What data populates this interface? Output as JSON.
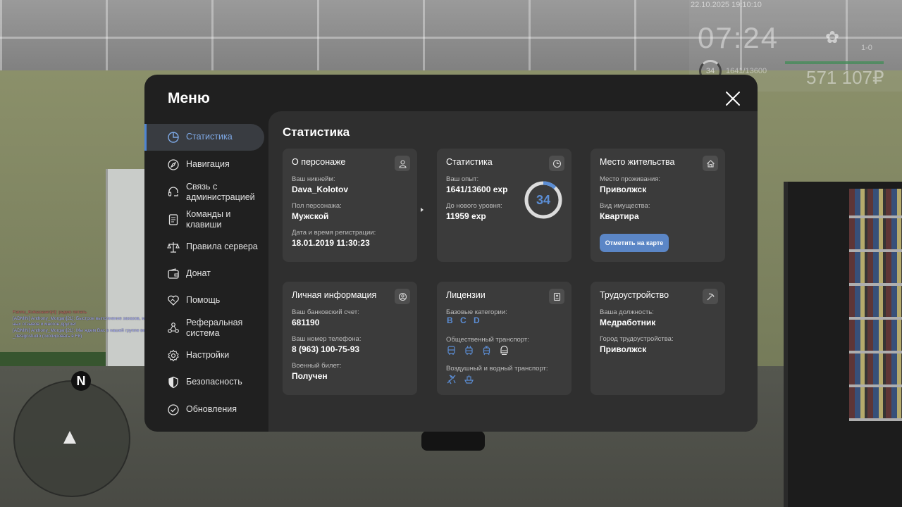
{
  "hud": {
    "datetime": "22.10.2025 19:10:10",
    "time": "07:24",
    "weapon_icon": "grenade-icon",
    "ammo": "1-0",
    "level": "34",
    "exp": "1641/13600",
    "money": "571 107₽"
  },
  "chat": {
    "lines": [
      "Fannu_Kokacasen[4]: радио питать",
      "[ADMIN] Anthony_Morgan[21]: Быстрое выполнение заказов, много положитель",
      "ных отзывов и многое другое!",
      "[ADMIN] Anthony_Morgan[21]: Мы ждем Вас в нашей группе вк: vk.com/effect",
      "_designstudio (скопировать в F8)"
    ]
  },
  "minimap": {
    "north_label": "N"
  },
  "menu": {
    "title": "Меню",
    "close_icon": "close-icon",
    "accent_color": "#4e84d2",
    "sidebar": [
      {
        "label": "Статистика",
        "icon": "pie-chart-icon",
        "active": true
      },
      {
        "label": "Навигация",
        "icon": "compass-icon",
        "active": false
      },
      {
        "label": "Связь с администрацией",
        "icon": "headset-icon",
        "active": false
      },
      {
        "label": "Команды и клавиши",
        "icon": "document-icon",
        "active": false
      },
      {
        "label": "Правила сервера",
        "icon": "scales-icon",
        "active": false
      },
      {
        "label": "Донат",
        "icon": "wallet-icon",
        "active": false
      },
      {
        "label": "Помощь",
        "icon": "heart-handshake-icon",
        "active": false
      },
      {
        "label": "Реферальная система",
        "icon": "share-icon",
        "active": false
      },
      {
        "label": "Настройки",
        "icon": "gear-icon",
        "active": false
      },
      {
        "label": "Безопасность",
        "icon": "shield-icon",
        "active": false
      },
      {
        "label": "Обновления",
        "icon": "check-circle-icon",
        "active": false
      }
    ]
  },
  "content": {
    "title": "Статистика",
    "character": {
      "title": "О персонаже",
      "icon": "user-icon",
      "nickname_label": "Ваш никнейм:",
      "nickname": "Dava_Kolotov",
      "gender_label": "Пол персонажа:",
      "gender": "Мужской",
      "reg_label": "Дата и время регистрации:",
      "reg_date": "18.01.2019 11:30:23"
    },
    "stats": {
      "title": "Статистика",
      "icon": "clock-icon",
      "exp_label": "Ваш опыт:",
      "exp": "1641/13600 exp",
      "next_label": "До нового уровня:",
      "next": "11959 exp",
      "level": "34",
      "progress": 0.12
    },
    "residence": {
      "title": "Место жительства",
      "icon": "house-icon",
      "place_label": "Место проживания:",
      "place": "Приволжск",
      "property_label": "Вид имущества:",
      "property": "Квартира",
      "map_button": "Отметить на карте"
    },
    "personal": {
      "title": "Личная информация",
      "icon": "user-circle-icon",
      "bank_label": "Ваш банковский счет:",
      "bank": "681190",
      "phone_label": "Ваш номер телефона:",
      "phone": "8 (963) 100-75-93",
      "military_label": "Военный билет:",
      "military": "Получен"
    },
    "licenses": {
      "title": "Лицензии",
      "icon": "id-badge-icon",
      "base_label": "Базовые категории:",
      "base": "B C D",
      "public_label": "Общественный транспорт:",
      "public_icons": [
        "bus-icon",
        "trolleybus-icon",
        "tram-icon",
        "metro-icon"
      ],
      "air_label": "Воздушный и водный транспорт:",
      "air_icons": [
        "plane-icon",
        "boat-icon"
      ]
    },
    "employment": {
      "title": "Трудоустройство",
      "icon": "pickaxe-icon",
      "position_label": "Ваша должность:",
      "position": "Медработник",
      "city_label": "Город трудоустройства:",
      "city": "Приволжск"
    }
  }
}
